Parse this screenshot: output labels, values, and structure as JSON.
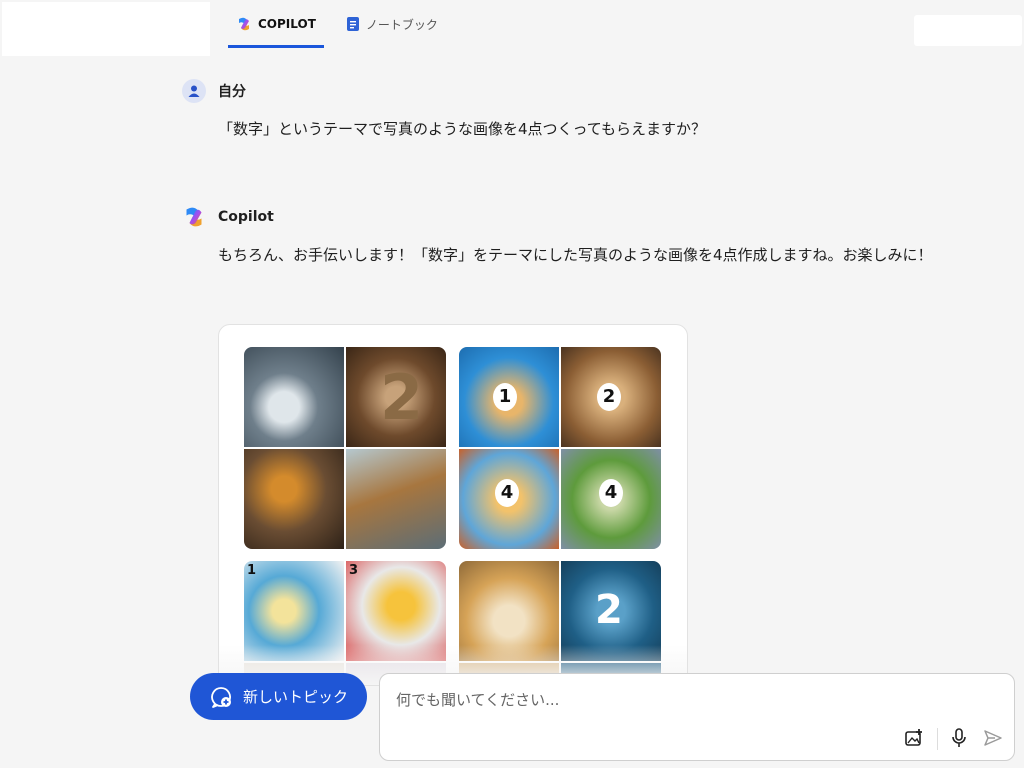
{
  "tabs": [
    {
      "label": "COPILOT",
      "active": true
    },
    {
      "label": "ノートブック",
      "active": false
    }
  ],
  "user_message": {
    "name": "自分",
    "text": "「数字」というテーマで写真のような画像を4点つくってもらえますか？"
  },
  "copilot_message": {
    "name": "Copilot",
    "text": "もちろん、お手伝いします！「数字」をテーマにした写真のような画像を4点作成しますね。お楽しみに！"
  },
  "image_tiles": [
    {
      "digits": [
        "",
        "2",
        "",
        ""
      ]
    },
    {
      "digits": [
        "1",
        "2",
        "4",
        "4"
      ]
    },
    {
      "digits": [
        "1",
        "3",
        "",
        ""
      ]
    },
    {
      "digits": [
        "",
        "2",
        "",
        ""
      ]
    }
  ],
  "new_topic": {
    "label": "新しいトピック"
  },
  "composer": {
    "placeholder": "何でも聞いてください..."
  },
  "colors": {
    "accent": "#1f56d6",
    "background": "#f5f5f5"
  }
}
